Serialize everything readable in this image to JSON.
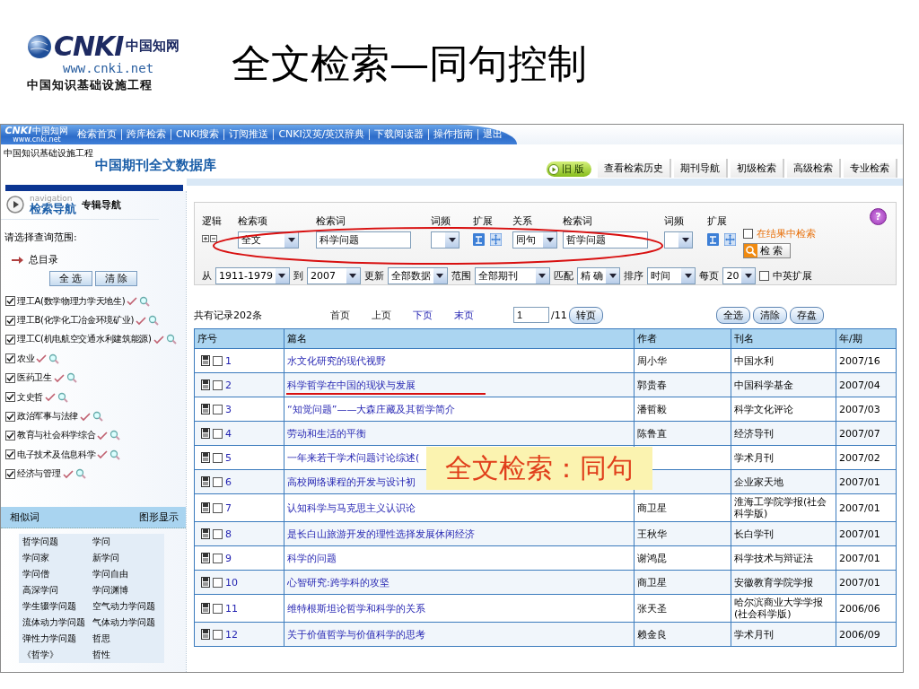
{
  "slide": {
    "logo": {
      "latin": "CNKI",
      "chinese": "中国知网",
      "url": "www.cnki.net",
      "tagline": "中国知识基础设施工程"
    },
    "title": "全文检索—同句控制",
    "callout": "全文检索：同句"
  },
  "app": {
    "logo": {
      "latin": "CNKI",
      "chinese": "中国知网",
      "url": "www.cnki.net"
    },
    "nav_links": [
      "检索首页",
      "跨库检索",
      "CNKI搜索",
      "订阅推送",
      "CNKI汉英/英汉辞典",
      "下载阅读器",
      "操作指南",
      "退出"
    ],
    "tagline": "中国知识基础设施工程",
    "database_title": "中国期刊全文数据库",
    "old_version": "旧 版",
    "tabs": [
      {
        "label": "查看检索历史",
        "selected": false
      },
      {
        "label": "期刊导航",
        "selected": false
      },
      {
        "label": "初级检索",
        "selected": false
      },
      {
        "label": "高级检索",
        "selected": false
      },
      {
        "label": "专业检索",
        "selected": false
      }
    ]
  },
  "sidebar": {
    "nav_caption": "navigation",
    "nav_tabs": [
      {
        "label": "检索导航",
        "selected": true
      },
      {
        "label": "专辑导航",
        "selected": false
      }
    ],
    "scope_label": "请选择查询范围:",
    "root": "总目录",
    "buttons": [
      "全 选",
      "清 除"
    ],
    "categories": [
      {
        "label": "理工A(数学物理力学天地生)",
        "checked": true
      },
      {
        "label": "理工B(化学化工冶金环境矿业)",
        "checked": true
      },
      {
        "label": "理工C(机电航空交通水利建筑能源)",
        "checked": true
      },
      {
        "label": "农业",
        "checked": true
      },
      {
        "label": "医药卫生",
        "checked": true
      },
      {
        "label": "文史哲",
        "checked": true
      },
      {
        "label": "政治军事与法律",
        "checked": true
      },
      {
        "label": "教育与社会科学综合",
        "checked": true
      },
      {
        "label": "电子技术及信息科学",
        "checked": true
      },
      {
        "label": "经济与管理",
        "checked": true
      }
    ],
    "similar_header": "相似词",
    "graph_link": "图形显示",
    "similar_words": [
      [
        "哲学问题",
        "学问"
      ],
      [
        "学问家",
        "新学问"
      ],
      [
        "学问僧",
        "学问自由"
      ],
      [
        "高深学问",
        "学问渊博"
      ],
      [
        "学生辍学问题",
        "空气动力学问题"
      ],
      [
        "流体动力学问题",
        "气体动力学问题"
      ],
      [
        "弹性力学问题",
        "哲思"
      ],
      [
        "《哲学》",
        "哲性"
      ]
    ]
  },
  "search": {
    "help": "?",
    "conditions": [
      {
        "kind": "logic",
        "label": "逻辑"
      },
      {
        "kind": "select",
        "label": "检索项",
        "value": "全文"
      },
      {
        "kind": "input",
        "label": "检索词",
        "value": "科学问题"
      },
      {
        "kind": "select",
        "label": "词频"
      },
      {
        "kind": "expand",
        "label": "扩展"
      },
      {
        "kind": "select",
        "label": "关系",
        "value": "同句"
      },
      {
        "kind": "input",
        "label": "检索词",
        "value": "哲学问题"
      },
      {
        "kind": "select",
        "label": "词频"
      },
      {
        "kind": "expand",
        "label": "扩展"
      }
    ],
    "in_results": {
      "label": "在结果中检索",
      "checked": false
    },
    "search_button": "检 索",
    "filters": [
      {
        "label": "从",
        "value": "1911-1979"
      },
      {
        "label": "到",
        "value": "2007"
      },
      {
        "label": "更新",
        "value": "全部数据"
      },
      {
        "label": "范围",
        "value": "全部期刊"
      },
      {
        "label": "匹配",
        "value": "精 确"
      },
      {
        "label": "排序",
        "value": "时间"
      },
      {
        "label": "每页",
        "value": "20"
      }
    ],
    "bilingual": {
      "label": "中英扩展",
      "checked": false
    }
  },
  "results": {
    "total": "共有记录202条",
    "pager": [
      {
        "label": "首页",
        "disabled": true
      },
      {
        "label": "上页",
        "disabled": true
      },
      {
        "label": "下页",
        "disabled": false
      },
      {
        "label": "末页",
        "disabled": false
      }
    ],
    "page": "1",
    "page_count": "/11",
    "go_button": "转页",
    "actions": [
      "全选",
      "清除",
      "存盘"
    ],
    "columns": [
      "序号",
      "篇名",
      "作者",
      "刊名",
      "年/期"
    ],
    "rows": [
      {
        "index": "1",
        "checked": false,
        "title": "水文化研究的现代视野",
        "author": "周小华",
        "journal": "中国水利",
        "issue": "2007/16"
      },
      {
        "index": "2",
        "checked": false,
        "title": "科学哲学在中国的现状与发展",
        "author": "郭贵春",
        "journal": "中国科学基金",
        "issue": "2007/04"
      },
      {
        "index": "3",
        "checked": false,
        "title": "“知觉问题”——大森庄藏及其哲学简介",
        "author": "潘哲毅",
        "journal": "科学文化评论",
        "issue": "2007/03"
      },
      {
        "index": "4",
        "checked": false,
        "title": "劳动和生活的平衡",
        "author": "陈鲁直",
        "journal": "经济导刊",
        "issue": "2007/07"
      },
      {
        "index": "5",
        "checked": false,
        "title": "一年来若干学术问题讨论综述(",
        "journal": "学术月刊",
        "issue": "2007/02"
      },
      {
        "index": "6",
        "checked": false,
        "title": "高校网络课程的开发与设计初",
        "journal": "企业家天地",
        "issue": "2007/01"
      },
      {
        "index": "7",
        "checked": false,
        "title": "认知科学与马克思主义认识论",
        "author": "商卫星",
        "journal": "淮海工学院学报(社会科学版)",
        "issue": "2007/01"
      },
      {
        "index": "8",
        "checked": false,
        "title": "是长白山旅游开发的理性选择发展休闲经济",
        "author": "王秋华",
        "journal": "长白学刊",
        "issue": "2007/01"
      },
      {
        "index": "9",
        "checked": false,
        "title": "科学的问题",
        "author": "谢鸿昆",
        "journal": "科学技术与辩证法",
        "issue": "2007/01"
      },
      {
        "index": "10",
        "checked": false,
        "title": "心智研究:跨学科的攻坚",
        "author": "商卫星",
        "journal": "安徽教育学院学报",
        "issue": "2007/01"
      },
      {
        "index": "11",
        "checked": false,
        "title": "维特根斯坦论哲学和科学的关系",
        "author": "张天圣",
        "journal": "哈尔滨商业大学学报(社会科学版)",
        "issue": "2006/06"
      },
      {
        "index": "12",
        "checked": false,
        "title": "关于价值哲学与价值科学的思考",
        "author": "赖金良",
        "journal": "学术月刊",
        "issue": "2006/09"
      }
    ]
  }
}
